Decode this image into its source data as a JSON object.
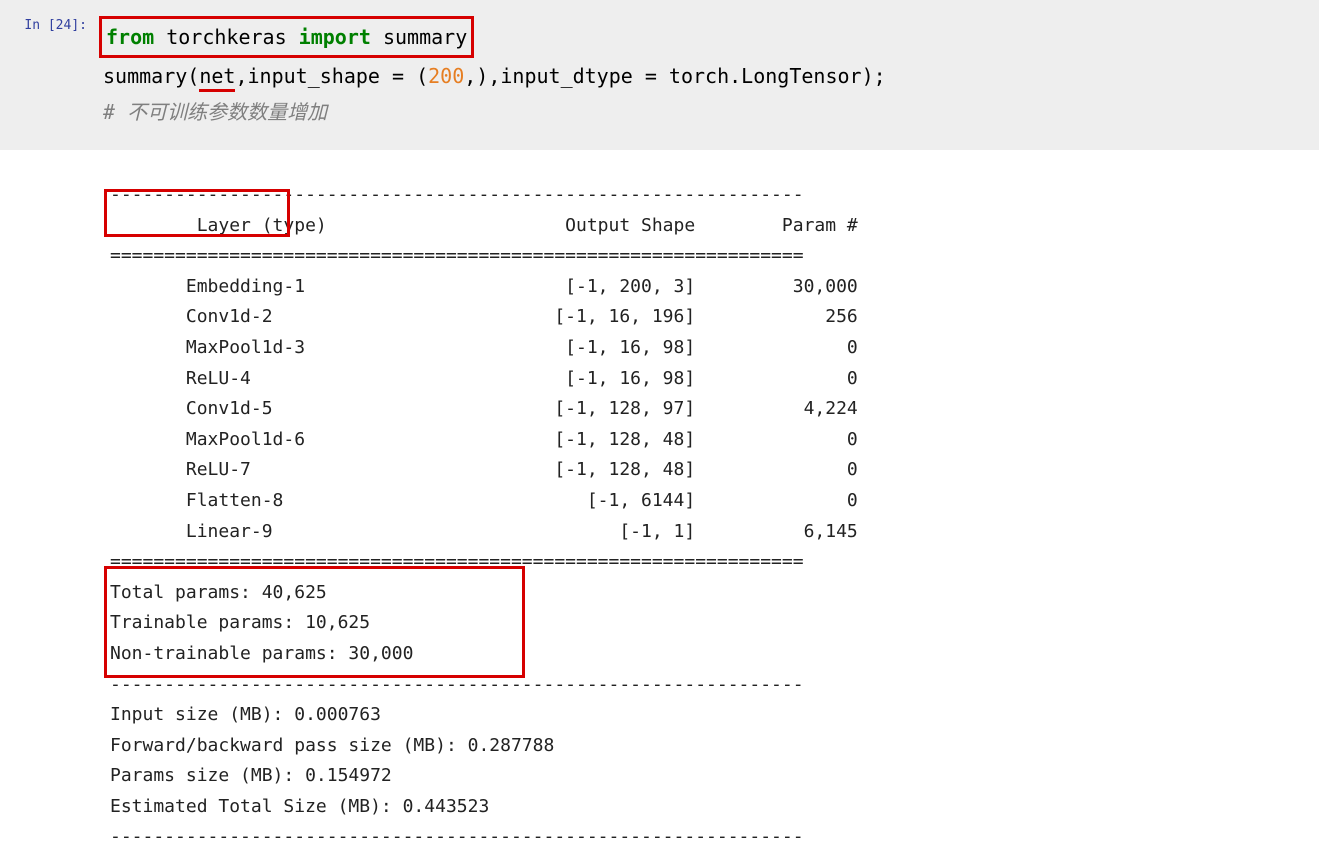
{
  "prompt": "In [24]:",
  "code": {
    "line1_pre": "from",
    "line1_mod": " torchkeras ",
    "line1_imp": "import",
    "line1_sym": " summary",
    "line2_pre": "summary(",
    "line2_net": "net",
    "line2_mid": ",input_shape = (",
    "line2_num": "200",
    "line2_post": ",),input_dtype = torch.LongTensor);",
    "line3_comment": "# 不可训练参数数量增加"
  },
  "output": {
    "dash_line": "----------------------------------------------------------------",
    "eq_line": "================================================================",
    "header_layer": "Layer (type)",
    "header_shape": "Output Shape",
    "header_param": "Param #",
    "layers": [
      {
        "name": "Embedding-1",
        "shape": "[-1, 200, 3]",
        "params": "30,000"
      },
      {
        "name": "Conv1d-2",
        "shape": "[-1, 16, 196]",
        "params": "256"
      },
      {
        "name": "MaxPool1d-3",
        "shape": "[-1, 16, 98]",
        "params": "0"
      },
      {
        "name": "ReLU-4",
        "shape": "[-1, 16, 98]",
        "params": "0"
      },
      {
        "name": "Conv1d-5",
        "shape": "[-1, 128, 97]",
        "params": "4,224"
      },
      {
        "name": "MaxPool1d-6",
        "shape": "[-1, 128, 48]",
        "params": "0"
      },
      {
        "name": "ReLU-7",
        "shape": "[-1, 128, 48]",
        "params": "0"
      },
      {
        "name": "Flatten-8",
        "shape": "[-1, 6144]",
        "params": "0"
      },
      {
        "name": "Linear-9",
        "shape": "[-1, 1]",
        "params": "6,145"
      }
    ],
    "totals": {
      "total": "Total params: 40,625",
      "trainable": "Trainable params: 10,625",
      "nontrainable": "Non-trainable params: 30,000"
    },
    "sizes": {
      "input": "Input size (MB): 0.000763",
      "fwdback": "Forward/backward pass size (MB): 0.287788",
      "params": "Params size (MB): 0.154972",
      "total": "Estimated Total Size (MB): 0.443523"
    }
  }
}
